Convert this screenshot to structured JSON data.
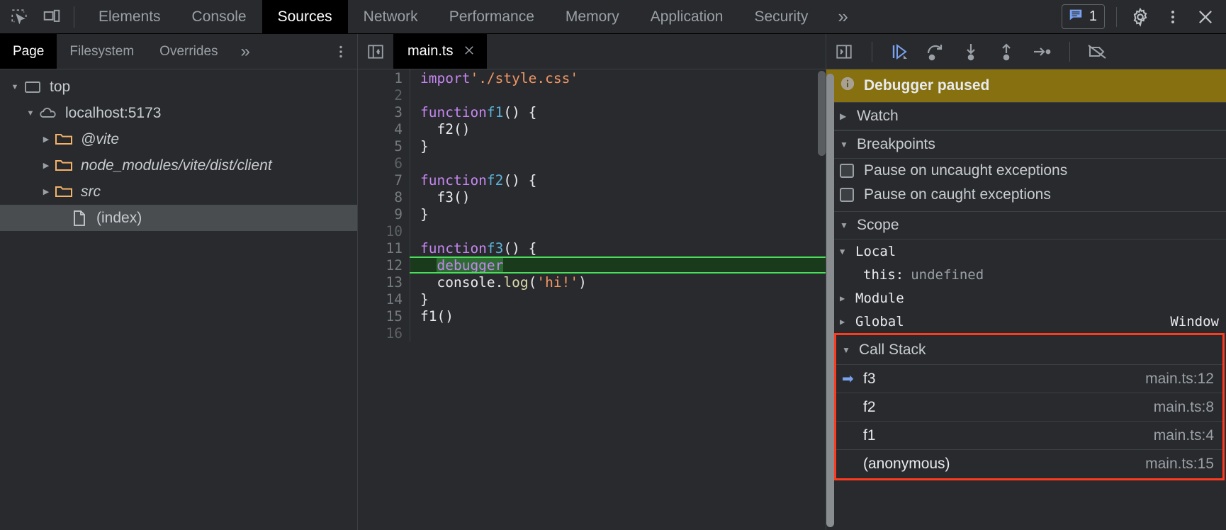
{
  "toolbar": {
    "inspect_icon": "inspect-element-icon",
    "device_icon": "device-toolbar-icon",
    "tabs": [
      {
        "label": "Elements",
        "active": false
      },
      {
        "label": "Console",
        "active": false
      },
      {
        "label": "Sources",
        "active": true
      },
      {
        "label": "Network",
        "active": false
      },
      {
        "label": "Performance",
        "active": false
      },
      {
        "label": "Memory",
        "active": false
      },
      {
        "label": "Application",
        "active": false
      },
      {
        "label": "Security",
        "active": false
      }
    ],
    "more_tabs": "»",
    "message_count": "1",
    "message_icon": "message-icon",
    "settings_icon": "gear-icon",
    "kebab_icon": "more-options-icon",
    "close_icon": "close-icon"
  },
  "navigator": {
    "tabs": [
      {
        "label": "Page",
        "active": true
      },
      {
        "label": "Filesystem",
        "active": false
      },
      {
        "label": "Overrides",
        "active": false
      }
    ],
    "more_tabs": "»",
    "kebab_icon": "more-options-icon",
    "tree": [
      {
        "label": "top",
        "icon": "frame-icon",
        "twisty": "▼",
        "indent": 0,
        "italic": false,
        "selected": false
      },
      {
        "label": "localhost:5173",
        "icon": "cloud-icon",
        "twisty": "▼",
        "indent": 1,
        "italic": false,
        "selected": false
      },
      {
        "label": "@vite",
        "icon": "folder-icon",
        "twisty": "▶",
        "indent": 2,
        "italic": true,
        "selected": false
      },
      {
        "label": "node_modules/vite/dist/client",
        "icon": "folder-icon",
        "twisty": "▶",
        "indent": 2,
        "italic": true,
        "selected": false
      },
      {
        "label": "src",
        "icon": "folder-icon",
        "twisty": "▶",
        "indent": 2,
        "italic": true,
        "selected": false
      },
      {
        "label": "(index)",
        "icon": "file-icon",
        "twisty": "",
        "indent": 3,
        "italic": false,
        "selected": true
      }
    ]
  },
  "editor": {
    "pane_toggle_icon": "show-navigator-icon",
    "file_tab": {
      "label": "main.ts",
      "close_icon": "close-icon"
    },
    "paused_line": 12,
    "lines": [
      {
        "no": "1",
        "blank": false,
        "tokens": [
          {
            "t": "import",
            "c": "kw"
          },
          {
            "t": " ",
            "c": "plain"
          },
          {
            "t": "'./style.css'",
            "c": "str"
          }
        ]
      },
      {
        "no": "2",
        "blank": true,
        "tokens": []
      },
      {
        "no": "3",
        "blank": false,
        "tokens": [
          {
            "t": "function",
            "c": "kw"
          },
          {
            "t": " ",
            "c": "plain"
          },
          {
            "t": "f1",
            "c": "fn"
          },
          {
            "t": "() {",
            "c": "plain"
          }
        ]
      },
      {
        "no": "4",
        "blank": false,
        "tokens": [
          {
            "t": "  f2()",
            "c": "plain"
          }
        ]
      },
      {
        "no": "5",
        "blank": false,
        "tokens": [
          {
            "t": "}",
            "c": "plain"
          }
        ]
      },
      {
        "no": "6",
        "blank": true,
        "tokens": []
      },
      {
        "no": "7",
        "blank": false,
        "tokens": [
          {
            "t": "function",
            "c": "kw"
          },
          {
            "t": " ",
            "c": "plain"
          },
          {
            "t": "f2",
            "c": "fn"
          },
          {
            "t": "() {",
            "c": "plain"
          }
        ]
      },
      {
        "no": "8",
        "blank": false,
        "tokens": [
          {
            "t": "  f3()",
            "c": "plain"
          }
        ]
      },
      {
        "no": "9",
        "blank": false,
        "tokens": [
          {
            "t": "}",
            "c": "plain"
          }
        ]
      },
      {
        "no": "10",
        "blank": true,
        "tokens": []
      },
      {
        "no": "11",
        "blank": false,
        "tokens": [
          {
            "t": "function",
            "c": "kw"
          },
          {
            "t": " ",
            "c": "plain"
          },
          {
            "t": "f3",
            "c": "fn"
          },
          {
            "t": "() {",
            "c": "plain"
          }
        ]
      },
      {
        "no": "12",
        "blank": false,
        "paused": true,
        "tokens": [
          {
            "t": "  ",
            "c": "plain"
          },
          {
            "t": "debugger",
            "c": "dbg"
          }
        ]
      },
      {
        "no": "13",
        "blank": false,
        "tokens": [
          {
            "t": "  console.",
            "c": "plain"
          },
          {
            "t": "log",
            "c": "prop"
          },
          {
            "t": "(",
            "c": "plain"
          },
          {
            "t": "'hi!'",
            "c": "str"
          },
          {
            "t": ")",
            "c": "plain"
          }
        ]
      },
      {
        "no": "14",
        "blank": false,
        "tokens": [
          {
            "t": "}",
            "c": "plain"
          }
        ]
      },
      {
        "no": "15",
        "blank": false,
        "tokens": [
          {
            "t": "f1()",
            "c": "plain"
          }
        ]
      },
      {
        "no": "16",
        "blank": true,
        "tokens": []
      }
    ]
  },
  "debug_toolbar": {
    "resume_icon": "resume-script-icon",
    "step_over_icon": "step-over-icon",
    "step_into_icon": "step-into-icon",
    "step_out_icon": "step-out-icon",
    "step_icon": "step-icon",
    "deactivate_breakpoints_icon": "deactivate-breakpoints-icon"
  },
  "debugger_panel": {
    "banner": {
      "icon": "info-icon",
      "text": "Debugger paused"
    },
    "watch": {
      "label": "Watch",
      "caret": "▶"
    },
    "breakpoints": {
      "label": "Breakpoints",
      "caret": "▼",
      "options": [
        {
          "label": "Pause on uncaught exceptions",
          "checked": false
        },
        {
          "label": "Pause on caught exceptions",
          "checked": false
        }
      ]
    },
    "scope": {
      "label": "Scope",
      "caret": "▼",
      "entries": [
        {
          "name": "Local",
          "caret": "▼",
          "value": "",
          "indent": false,
          "right": ""
        },
        {
          "name": "this:",
          "caret": "",
          "value": "undefined",
          "indent": true,
          "right": ""
        },
        {
          "name": "Module",
          "caret": "▶",
          "value": "",
          "indent": false,
          "right": ""
        },
        {
          "name": "Global",
          "caret": "▶",
          "value": "",
          "indent": false,
          "right": "Window"
        }
      ]
    },
    "call_stack": {
      "label": "Call Stack",
      "caret": "▼",
      "highlight_color": "#ff3b1f",
      "frames": [
        {
          "name": "f3",
          "location": "main.ts:12",
          "current": true
        },
        {
          "name": "f2",
          "location": "main.ts:8",
          "current": false
        },
        {
          "name": "f1",
          "location": "main.ts:4",
          "current": false
        },
        {
          "name": "(anonymous)",
          "location": "main.ts:15",
          "current": false
        }
      ]
    }
  }
}
